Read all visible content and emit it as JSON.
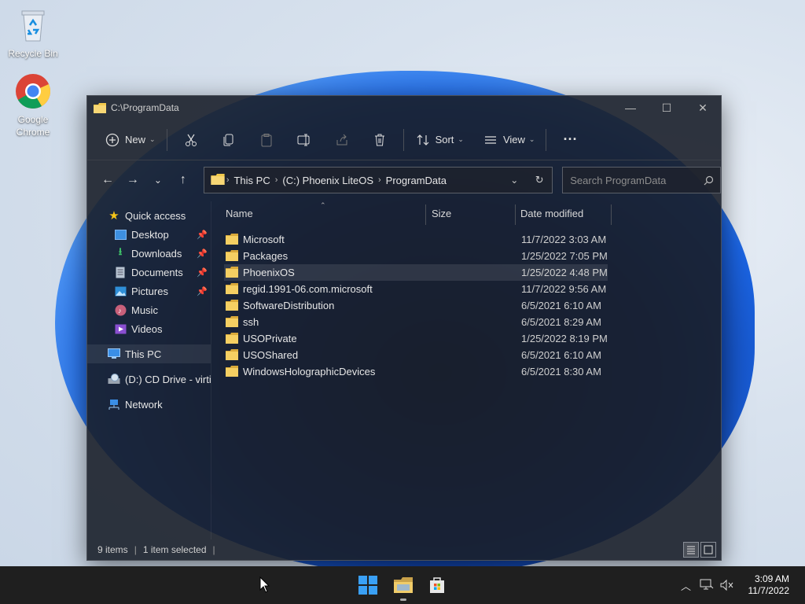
{
  "desktop": {
    "icons": [
      {
        "label": "Recycle Bin",
        "icon": "recycle-bin-icon"
      },
      {
        "label": "Google Chrome",
        "icon": "chrome-icon"
      }
    ]
  },
  "window": {
    "title": "C:\\ProgramData",
    "controls": {
      "minimize": "—",
      "maximize": "☐",
      "close": "✕"
    }
  },
  "toolbar": {
    "new_label": "New",
    "sort_label": "Sort",
    "view_label": "View",
    "more_label": "···"
  },
  "address": {
    "crumbs": [
      "This PC",
      "(C:) Phoenix LiteOS",
      "ProgramData"
    ],
    "search_placeholder": "Search ProgramData"
  },
  "nav": {
    "quick_access": "Quick access",
    "items": [
      {
        "label": "Desktop",
        "pinned": true
      },
      {
        "label": "Downloads",
        "pinned": true
      },
      {
        "label": "Documents",
        "pinned": true
      },
      {
        "label": "Pictures",
        "pinned": true
      },
      {
        "label": "Music",
        "pinned": false
      },
      {
        "label": "Videos",
        "pinned": false
      }
    ],
    "this_pc": "This PC",
    "cd_drive": "(D:) CD Drive - virti",
    "network": "Network"
  },
  "columns": {
    "name": "Name",
    "size": "Size",
    "date": "Date modified"
  },
  "files": [
    {
      "name": "Microsoft",
      "date": "11/7/2022 3:03 AM"
    },
    {
      "name": "Packages",
      "date": "1/25/2022 7:05 PM"
    },
    {
      "name": "PhoenixOS",
      "date": "1/25/2022 4:48 PM",
      "selected": true
    },
    {
      "name": "regid.1991-06.com.microsoft",
      "date": "11/7/2022 9:56 AM"
    },
    {
      "name": "SoftwareDistribution",
      "date": "6/5/2021 6:10 AM"
    },
    {
      "name": "ssh",
      "date": "6/5/2021 8:29 AM"
    },
    {
      "name": "USOPrivate",
      "date": "1/25/2022 8:19 PM"
    },
    {
      "name": "USOShared",
      "date": "6/5/2021 6:10 AM"
    },
    {
      "name": "WindowsHolographicDevices",
      "date": "6/5/2021 8:30 AM"
    }
  ],
  "status": {
    "items": "9 items",
    "selected": "1 item selected"
  },
  "taskbar": {
    "time": "3:09 AM",
    "date": "11/7/2022"
  }
}
